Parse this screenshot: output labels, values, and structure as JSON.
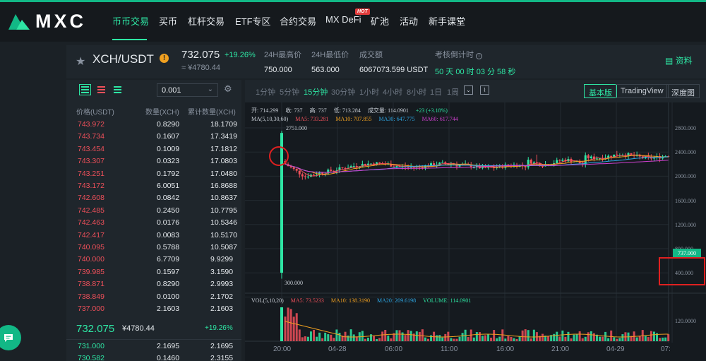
{
  "brand": {
    "name": "MXC"
  },
  "nav": {
    "items": [
      "币币交易",
      "买币",
      "杠杆交易",
      "ETF专区",
      "合约交易",
      "MX DeFi",
      "矿池",
      "活动",
      "新手课堂"
    ],
    "hot_badge": "HOT"
  },
  "ticker": {
    "pair": "XCH/USDT",
    "price": "732.075",
    "change": "+19.26%",
    "cny": "≈ ¥4780.44",
    "high_label": "24H最高价",
    "high": "750.000",
    "low_label": "24H最低价",
    "low": "563.000",
    "volume_label": "成交额",
    "volume": "6067073.599 USDT",
    "countdown_label": "考核倒计时",
    "countdown": "50 天 00 时 03 分 58 秒",
    "doc_label": "资料"
  },
  "orderbook": {
    "precision": "0.001",
    "headers": [
      "价格(USDT)",
      "数量(XCH)",
      "累计数量(XCH)"
    ],
    "asks": [
      [
        "743.972",
        "0.8290",
        "18.1709"
      ],
      [
        "743.734",
        "0.1607",
        "17.3419"
      ],
      [
        "743.454",
        "0.1009",
        "17.1812"
      ],
      [
        "743.307",
        "0.0323",
        "17.0803"
      ],
      [
        "743.251",
        "0.1792",
        "17.0480"
      ],
      [
        "743.172",
        "6.0051",
        "16.8688"
      ],
      [
        "742.608",
        "0.0842",
        "10.8637"
      ],
      [
        "742.485",
        "0.2450",
        "10.7795"
      ],
      [
        "742.463",
        "0.0176",
        "10.5346"
      ],
      [
        "742.417",
        "0.0083",
        "10.5170"
      ],
      [
        "740.095",
        "0.5788",
        "10.5087"
      ],
      [
        "740.000",
        "6.7709",
        "9.9299"
      ],
      [
        "739.985",
        "0.1597",
        "3.1590"
      ],
      [
        "738.871",
        "0.8290",
        "2.9993"
      ],
      [
        "738.849",
        "0.0100",
        "2.1702"
      ],
      [
        "737.000",
        "2.1603",
        "2.1603"
      ]
    ],
    "mid_price": "732.075",
    "mid_cny": "¥4780.44",
    "mid_change": "+19.26%",
    "bids": [
      [
        "731.000",
        "2.1695",
        "2.1695"
      ],
      [
        "730.582",
        "0.1460",
        "2.3155"
      ]
    ]
  },
  "chart": {
    "intervals": [
      "1分钟",
      "5分钟",
      "15分钟",
      "30分钟",
      "1小时",
      "4小时",
      "8小时",
      "1日",
      "1周"
    ],
    "active_interval": "15分钟",
    "views": [
      "基本版",
      "TradingView",
      "深度图"
    ],
    "active_view": "基本版",
    "ohlc_line": [
      "开: 714.299",
      "收: 737",
      "高: 737",
      "低: 713.284",
      "成交量: 114.0901",
      "+23 (+3.18%)"
    ],
    "ma_line": [
      "MA(5,10,30,60)",
      "MA5: 733.281",
      "MA10: 707.855",
      "MA30: 647.775",
      "MA60: 617.744"
    ],
    "vol_line": [
      "VOL(5,10,20)",
      "MA5: 73.5233",
      "MA10: 138.3190",
      "MA20: 209.6198",
      "VOLUME: 114.0901"
    ],
    "high_marker": "2751.000",
    "low_marker": "300.000",
    "price_tag": "737.000",
    "y_ticks": [
      "2800.000",
      "2400.000",
      "2000.000",
      "1600.000",
      "1200.000",
      "800.000",
      "400.000"
    ],
    "vol_tick": "120.0000",
    "x_ticks": [
      "20:00",
      "04-28",
      "06:00",
      "11:00",
      "16:00",
      "21:00",
      "04-29",
      "07:"
    ]
  },
  "colors": {
    "accent": "#2ee6a4",
    "ask": "#f0505a",
    "ma5": "#f0505a",
    "ma10": "#f0a020",
    "ma30": "#2ea8e6",
    "ma60": "#d040d0",
    "vol": "#2ee6a4"
  }
}
